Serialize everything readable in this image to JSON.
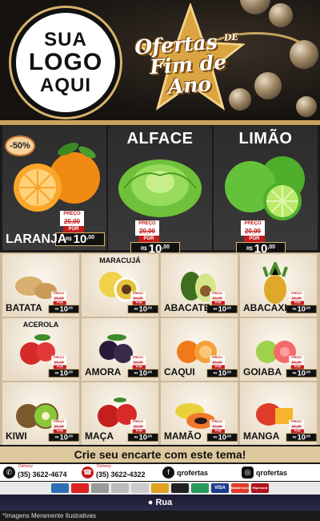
{
  "logo": {
    "line1": "SUA",
    "line2": "LOGO",
    "line3": "AQUI"
  },
  "banner": {
    "line1": "Ofertas",
    "de": "DE",
    "line2": "Fim de Ano"
  },
  "featured": [
    {
      "name": "LARANJA",
      "badge": "-50%",
      "price_label": "PREÇO",
      "old_price": "20,00",
      "por": "POR",
      "currency": "R$",
      "price_int": "10",
      "price_dec": ",00"
    },
    {
      "name": "ALFACE",
      "price_label": "PREÇO",
      "old_price": "20,00",
      "por": "POR",
      "currency": "R$",
      "price_int": "10",
      "price_dec": ",00"
    },
    {
      "name": "LIMÃO",
      "price_label": "PREÇO",
      "old_price": "20,00",
      "por": "POR",
      "currency": "R$",
      "price_int": "10",
      "price_dec": ",00"
    }
  ],
  "products": [
    {
      "name": "BATATA",
      "top_label": ""
    },
    {
      "name": "",
      "top_label": "MARACUJÁ"
    },
    {
      "name": "ABACATE",
      "top_label": ""
    },
    {
      "name": "ABACAXI",
      "top_label": ""
    },
    {
      "name": "",
      "top_label": "ACEROLA"
    },
    {
      "name": "AMORA",
      "top_label": ""
    },
    {
      "name": "CAQUI",
      "top_label": ""
    },
    {
      "name": "GOIABA",
      "top_label": ""
    },
    {
      "name": "KIWI",
      "top_label": ""
    },
    {
      "name": "MAÇA",
      "top_label": ""
    },
    {
      "name": "MAMÃO",
      "top_label": ""
    },
    {
      "name": "MANGA",
      "top_label": ""
    }
  ],
  "price_tag": {
    "price_label": "PREÇO",
    "old_price": "20,00",
    "por": "POR",
    "currency": "R$",
    "price_int": "10",
    "price_dec": ",00"
  },
  "cta": "Crie seu encarte com este tema!",
  "contacts": [
    {
      "icon": "whatsapp-icon",
      "label": "Delivery",
      "value": "(35) 3622-4674"
    },
    {
      "icon": "phone-icon",
      "label": "Delivery",
      "value": "(35) 3622-4322"
    },
    {
      "icon": "facebook-icon",
      "label": "",
      "value": "qrofertas"
    },
    {
      "icon": "instagram-icon",
      "label": "",
      "value": "qrofertas"
    }
  ],
  "payments": [
    "",
    "",
    "",
    "",
    "",
    "",
    "",
    "",
    "VISA",
    "MasterCard",
    "Hipercard"
  ],
  "address": "Rua",
  "disclaimer": "*Imagens Meramente Ilustrativas",
  "colors": {
    "gold": "#c9a35e",
    "red": "#c31c1c",
    "dark": "#1a1a1a"
  }
}
